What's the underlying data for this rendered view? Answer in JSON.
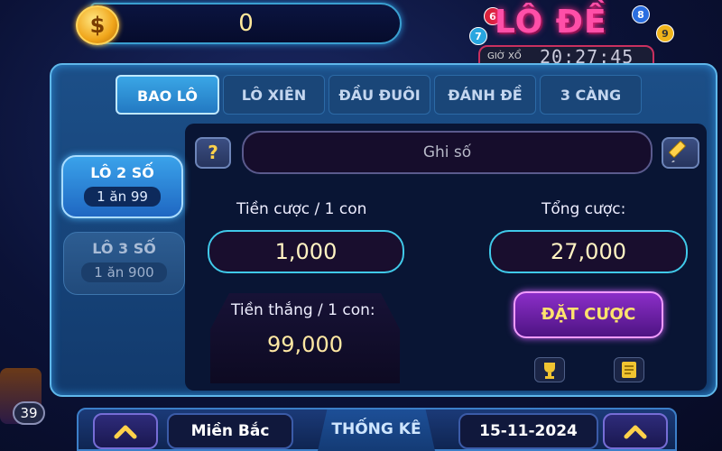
{
  "header": {
    "coin_balance": "0",
    "coin_symbol": "$",
    "game_title": "LÔ ĐỀ",
    "timer_label": "GIỜ XỔ",
    "timer_value": "20:27:45",
    "balls": [
      "6",
      "8",
      "7",
      "9"
    ]
  },
  "tabs": [
    {
      "label": "BAO LÔ",
      "active": true
    },
    {
      "label": "LÔ XIÊN",
      "active": false
    },
    {
      "label": "ĐẦU ĐUÔI",
      "active": false
    },
    {
      "label": "ĐÁNH ĐỀ",
      "active": false
    },
    {
      "label": "3 CÀNG",
      "active": false
    }
  ],
  "side_options": [
    {
      "title": "LÔ 2 SỐ",
      "payout": "1 ăn 99",
      "active": true
    },
    {
      "title": "LÔ 3 SỐ",
      "payout": "1 ăn 900",
      "active": false
    }
  ],
  "number_input": {
    "placeholder": "Ghi số",
    "help": "?"
  },
  "bet_per_unit": {
    "label": "Tiền cược / 1 con",
    "value": "1,000"
  },
  "total_bet": {
    "label": "Tổng cược:",
    "value": "27,000"
  },
  "win_per_unit": {
    "label": "Tiền thắng / 1 con:",
    "value": "99,000"
  },
  "place_bet_button": "ĐẶT CƯỢC",
  "bottom_bar": {
    "region": "Miền Bắc",
    "stats": "THỐNG KÊ",
    "date": "15-11-2024"
  },
  "badge_count": "39",
  "colors": {
    "accent": "#3aa6e6",
    "bet_button": "#8b2ec8",
    "title": "#ff4fa8",
    "gold": "#ffe36d"
  }
}
